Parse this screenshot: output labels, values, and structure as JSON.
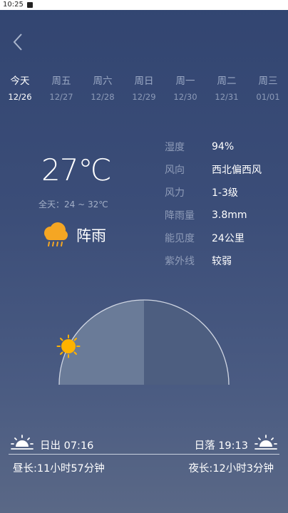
{
  "status_bar": {
    "time": "10:25"
  },
  "tabs": [
    {
      "day": "今天",
      "date": "12/26"
    },
    {
      "day": "周五",
      "date": "12/27"
    },
    {
      "day": "周六",
      "date": "12/28"
    },
    {
      "day": "周日",
      "date": "12/29"
    },
    {
      "day": "周一",
      "date": "12/30"
    },
    {
      "day": "周二",
      "date": "12/31"
    },
    {
      "day": "周三",
      "date": "01/01"
    }
  ],
  "current": {
    "temp": "27℃",
    "range": "全天：24 ~ 32℃",
    "weather": "阵雨",
    "icon": "rain-cloud-icon"
  },
  "details": [
    {
      "label": "湿度",
      "value": "94%"
    },
    {
      "label": "风向",
      "value": "西北偏西风"
    },
    {
      "label": "风力",
      "value": "1-3级"
    },
    {
      "label": "降雨量",
      "value": "3.8mm"
    },
    {
      "label": "能见度",
      "value": "24公里"
    },
    {
      "label": "紫外线",
      "value": "较弱"
    }
  ],
  "sun": {
    "sunrise": "日出 07:16",
    "sunset": "日落 19:13",
    "day_length": "昼长:11小时57分钟",
    "night_length": "夜长:12小时3分钟",
    "day_progress": 0.15
  },
  "colors": {
    "sun": "#ffb300",
    "cloud": "#f5a623",
    "dome_day": "#6a7b98",
    "dome_night": "#4d5e80"
  }
}
